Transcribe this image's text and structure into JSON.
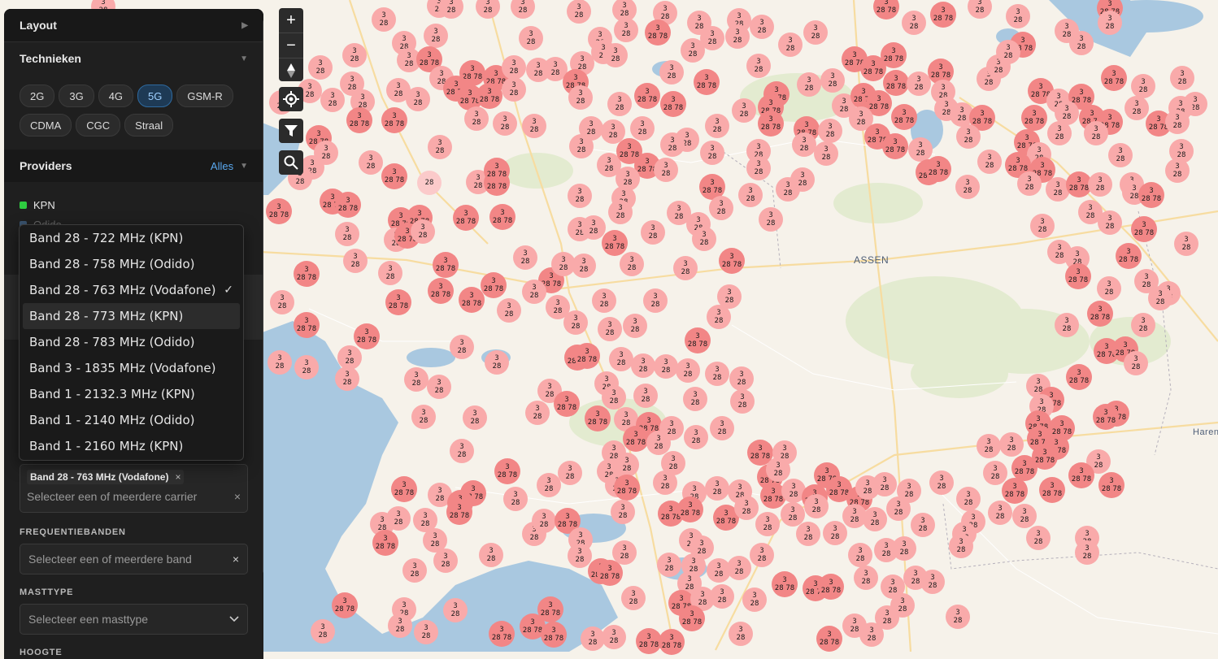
{
  "panel": {
    "layout_label": "Layout",
    "technieken_label": "Technieken",
    "techniques": [
      {
        "label": "2G",
        "active": false
      },
      {
        "label": "3G",
        "active": false
      },
      {
        "label": "4G",
        "active": false
      },
      {
        "label": "5G",
        "active": true
      },
      {
        "label": "GSM-R",
        "active": false
      },
      {
        "label": "CDMA",
        "active": false
      },
      {
        "label": "CGC",
        "active": false
      },
      {
        "label": "Straal",
        "active": false
      }
    ],
    "providers_label": "Providers",
    "providers_all": "Alles",
    "providers": [
      {
        "name": "KPN",
        "color": "#2ecc40"
      },
      {
        "name": "Odido",
        "color": "#5a7fa6"
      }
    ],
    "carrier_dropdown": {
      "options": [
        {
          "label": "Band 28 - 722 MHz (KPN)",
          "selected": false
        },
        {
          "label": "Band 28 - 758 MHz (Odido)",
          "selected": false
        },
        {
          "label": "Band 28 - 763 MHz (Vodafone)",
          "selected": true
        },
        {
          "label": "Band 28 - 773 MHz (KPN)",
          "selected": false
        },
        {
          "label": "Band 28 - 783 MHz (Odido)",
          "selected": false
        },
        {
          "label": "Band 3 - 1835 MHz (Vodafone)",
          "selected": false
        },
        {
          "label": "Band 1 - 2132.3 MHz (KPN)",
          "selected": false
        },
        {
          "label": "Band 1 - 2140 MHz (Odido)",
          "selected": false
        },
        {
          "label": "Band 1 - 2160 MHz (KPN)",
          "selected": false
        }
      ],
      "highlighted_index": 3,
      "check_mark": "✓"
    },
    "carrier_select": {
      "tag_label": "Band 28 - 763 MHz (Vodafone)",
      "tag_remove": "×",
      "placeholder": "Selecteer een of meerdere carrier",
      "clear": "×"
    },
    "frequentiebanden_label": "FREQUENTIEBANDEN",
    "frequentiebanden_placeholder": "Selecteer een of meerdere band",
    "frequentiebanden_clear": "×",
    "masttype_label": "MASTTYPE",
    "masttype_placeholder": "Selecteer een masttype",
    "hoogte_label": "HOOGTE"
  },
  "map": {
    "controls": {
      "zoom_in": "+",
      "zoom_out": "−"
    },
    "city_labels": [
      {
        "text": "ASSEN"
      },
      {
        "text": "Haren"
      }
    ],
    "marker_colors": {
      "light": "#f9aaaa",
      "dark": "#f28686",
      "pale": "#fbcaca"
    }
  }
}
